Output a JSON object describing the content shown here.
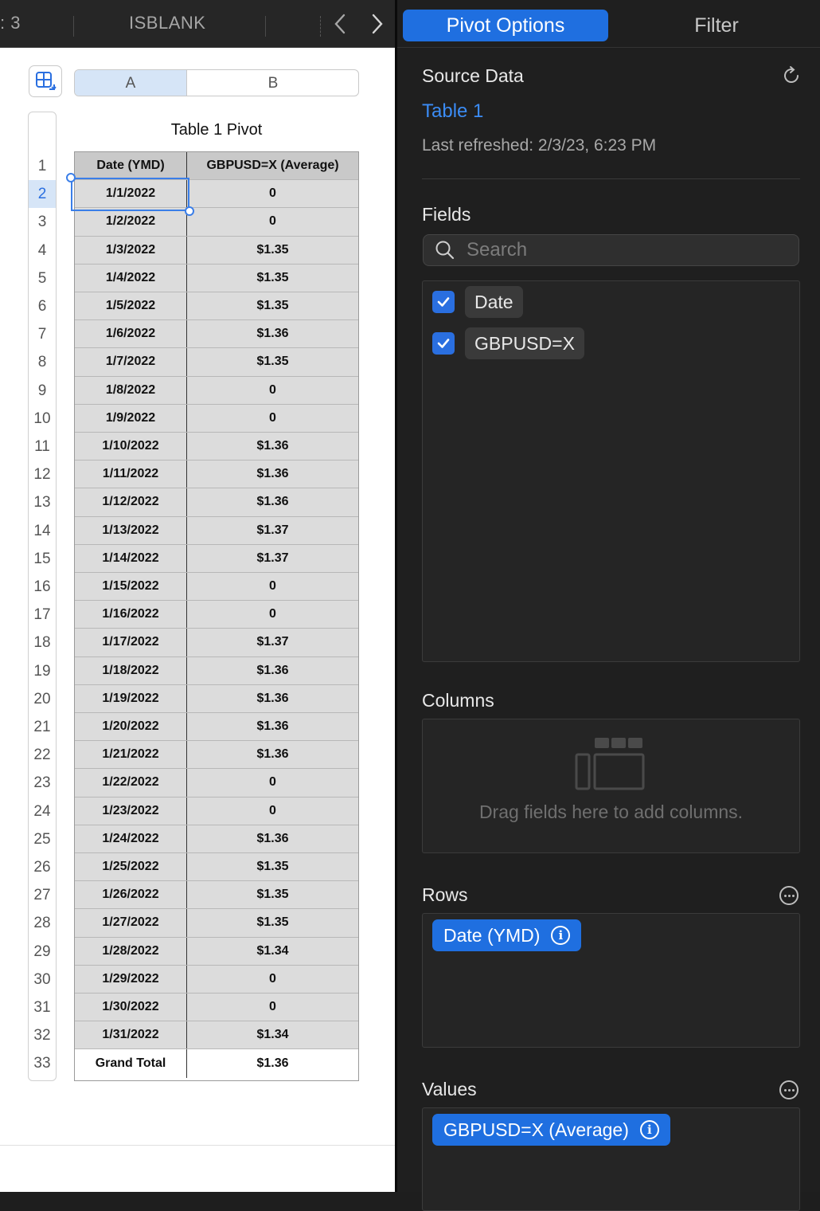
{
  "topbar": {
    "partial_label": ": 3",
    "function_label": "ISBLANK"
  },
  "sheet": {
    "table_title": "Table 1 Pivot",
    "columns": [
      "A",
      "B"
    ],
    "header": {
      "col_a": "Date (YMD)",
      "col_b": "GBPUSD=X (Average)"
    },
    "row_numbers": [
      "1",
      "2",
      "3",
      "4",
      "5",
      "6",
      "7",
      "8",
      "9",
      "10",
      "11",
      "12",
      "13",
      "14",
      "15",
      "16",
      "17",
      "18",
      "19",
      "20",
      "21",
      "22",
      "23",
      "24",
      "25",
      "26",
      "27",
      "28",
      "29",
      "30",
      "31",
      "32",
      "33"
    ],
    "rows": [
      {
        "date": "1/1/2022",
        "value": "0"
      },
      {
        "date": "1/2/2022",
        "value": "0"
      },
      {
        "date": "1/3/2022",
        "value": "$1.35"
      },
      {
        "date": "1/4/2022",
        "value": "$1.35"
      },
      {
        "date": "1/5/2022",
        "value": "$1.35"
      },
      {
        "date": "1/6/2022",
        "value": "$1.36"
      },
      {
        "date": "1/7/2022",
        "value": "$1.35"
      },
      {
        "date": "1/8/2022",
        "value": "0"
      },
      {
        "date": "1/9/2022",
        "value": "0"
      },
      {
        "date": "1/10/2022",
        "value": "$1.36"
      },
      {
        "date": "1/11/2022",
        "value": "$1.36"
      },
      {
        "date": "1/12/2022",
        "value": "$1.36"
      },
      {
        "date": "1/13/2022",
        "value": "$1.37"
      },
      {
        "date": "1/14/2022",
        "value": "$1.37"
      },
      {
        "date": "1/15/2022",
        "value": "0"
      },
      {
        "date": "1/16/2022",
        "value": "0"
      },
      {
        "date": "1/17/2022",
        "value": "$1.37"
      },
      {
        "date": "1/18/2022",
        "value": "$1.36"
      },
      {
        "date": "1/19/2022",
        "value": "$1.36"
      },
      {
        "date": "1/20/2022",
        "value": "$1.36"
      },
      {
        "date": "1/21/2022",
        "value": "$1.36"
      },
      {
        "date": "1/22/2022",
        "value": "0"
      },
      {
        "date": "1/23/2022",
        "value": "0"
      },
      {
        "date": "1/24/2022",
        "value": "$1.36"
      },
      {
        "date": "1/25/2022",
        "value": "$1.35"
      },
      {
        "date": "1/26/2022",
        "value": "$1.35"
      },
      {
        "date": "1/27/2022",
        "value": "$1.35"
      },
      {
        "date": "1/28/2022",
        "value": "$1.34"
      },
      {
        "date": "1/29/2022",
        "value": "0"
      },
      {
        "date": "1/30/2022",
        "value": "0"
      },
      {
        "date": "1/31/2022",
        "value": "$1.34"
      }
    ],
    "footer": {
      "label": "Grand Total",
      "value": "$1.36"
    }
  },
  "panel": {
    "tabs": {
      "pivot_options": "Pivot Options",
      "filter": "Filter"
    },
    "source_data": {
      "title": "Source Data",
      "table_link": "Table 1",
      "last_refreshed": "Last refreshed: 2/3/23, 6:23 PM"
    },
    "fields": {
      "title": "Fields",
      "search_placeholder": "Search",
      "items": [
        {
          "label": "Date",
          "checked": true
        },
        {
          "label": "GBPUSD=X",
          "checked": true
        }
      ]
    },
    "columns": {
      "title": "Columns",
      "hint": "Drag fields here to add columns."
    },
    "rows": {
      "title": "Rows",
      "pill": "Date (YMD)"
    },
    "values": {
      "title": "Values",
      "pill": "GBPUSD=X (Average)"
    }
  },
  "colors": {
    "accent": "#1f6fe0",
    "panel_bg": "#1f1f1f",
    "link": "#3b8cf5",
    "cell_bg": "#dcdcdc"
  }
}
